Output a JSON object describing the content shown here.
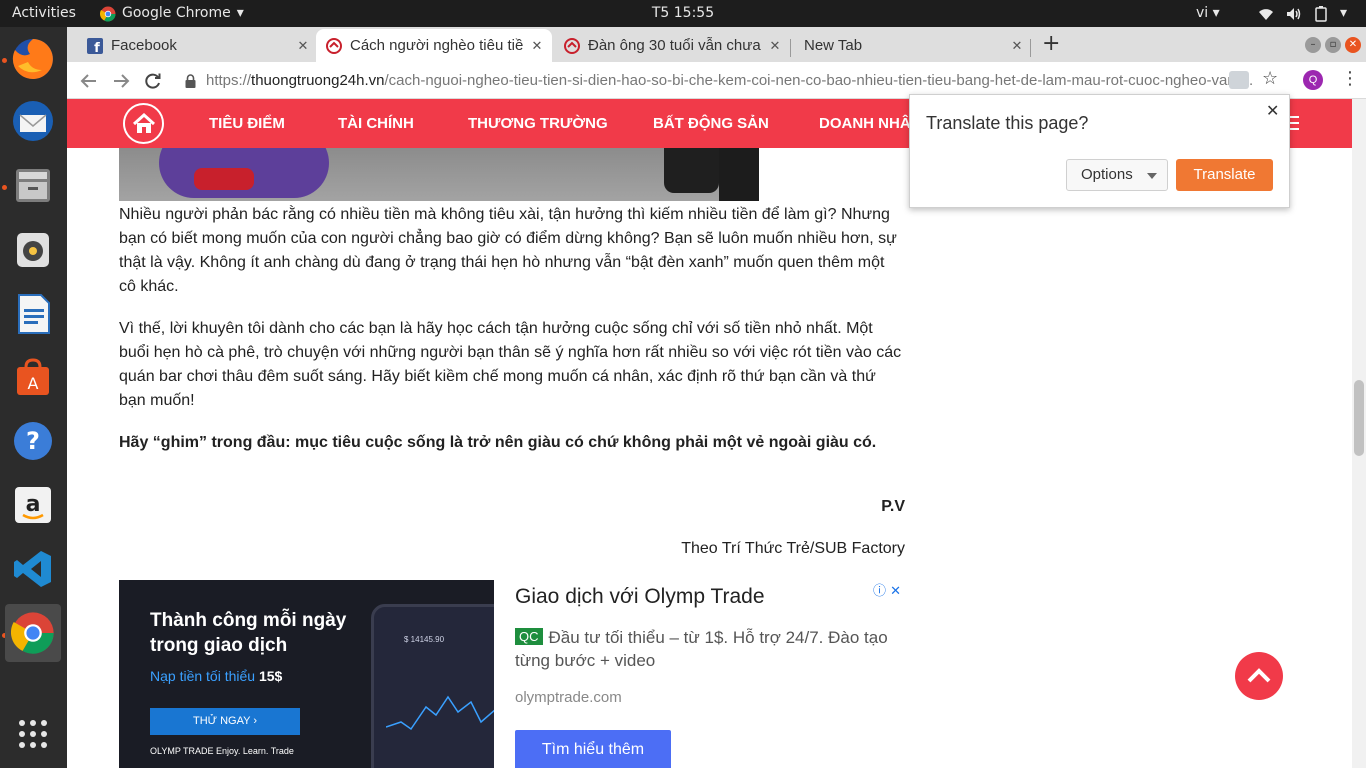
{
  "topbar": {
    "activities": "Activities",
    "app_name": "Google Chrome",
    "clock": "T5 15:55",
    "lang": "vi"
  },
  "dock": {
    "apps": [
      "firefox-icon",
      "thunderbird-icon",
      "files-icon",
      "rhythmbox-icon",
      "writer-icon",
      "software-icon",
      "help-icon",
      "amazon-icon",
      "vscode-icon",
      "chrome-icon",
      "app-grid-icon"
    ]
  },
  "tabs": [
    {
      "title": "Facebook"
    },
    {
      "title": "Cách người nghèo tiêu tiề"
    },
    {
      "title": "Đàn ông 30 tuổi vẫn chưa"
    },
    {
      "title": "New Tab"
    }
  ],
  "omnibox": {
    "proto": "https://",
    "host": "thuongtruong24h.vn",
    "path": "/cach-nguoi-ngheo-tieu-tien-si-dien-hao-so-bi-che-kem-coi-nen-co-bao-nhieu-tien-tieu-bang-het-de-lam-mau-rot-cuoc-ngheo-van-...",
    "profile_initial": "Q"
  },
  "site_nav": {
    "items": [
      "TIÊU ĐIỂM",
      "TÀI CHÍNH",
      "THƯƠNG TRƯỜNG",
      "BẤT ĐỘNG SẢN",
      "DOANH NHÂ"
    ]
  },
  "article": {
    "p1": "Nhiều người phản bác rằng có nhiều tiền mà không tiêu xài, tận hưởng thì kiếm nhiều tiền để làm gì? Nhưng bạn có biết mong muốn của con người chẳng bao giờ có điểm dừng không? Bạn sẽ luôn muốn nhiều hơn, sự thật là vậy. Không ít anh chàng dù đang ở trạng thái hẹn hò nhưng vẫn “bật đèn xanh” muốn quen thêm một cô khác.",
    "p2": "Vì thế, lời khuyên tôi dành cho các bạn là hãy học cách tận hưởng cuộc sống chỉ với số tiền nhỏ nhất. Một buổi hẹn hò cà phê, trò chuyện với những người bạn thân sẽ ý nghĩa hơn rất nhiều so với việc rót tiền vào các quán bar chơi thâu đêm suốt sáng. Hãy biết kiềm chế mong muốn cá nhân, xác định rõ thứ bạn cần và thứ bạn muốn!",
    "p3": "Hãy “ghim” trong đầu: mục tiêu cuộc sống là trở nên giàu có chứ không phải một vẻ ngoài giàu có.",
    "author": "P.V",
    "source": "Theo Trí Thức Trẻ/SUB Factory"
  },
  "ad": {
    "image_headline": "Thành công mỗi ngày trong giao dịch",
    "image_min_label": "Nạp tiền tối thiểu",
    "image_min_value": "15$",
    "image_cta": "THỬ NGAY  ›",
    "image_brand": "OLYMP TRADE  Enjoy. Learn. Trade",
    "phone_price": "$ 14145.90",
    "title": "Giao dịch với Olymp Trade",
    "badge": "QC",
    "description": "Đầu tư tối thiểu – từ 1$. Hỗ trợ 24/7. Đào tạo từng bước + video",
    "domain": "olymptrade.com",
    "button": "Tìm hiểu thêm"
  },
  "translate": {
    "title": "Translate this page?",
    "options": "Options",
    "translate": "Translate"
  },
  "colors": {
    "brand_red": "#f13a49",
    "translate_orange": "#f07833",
    "ad_button": "#4c6ef5"
  }
}
